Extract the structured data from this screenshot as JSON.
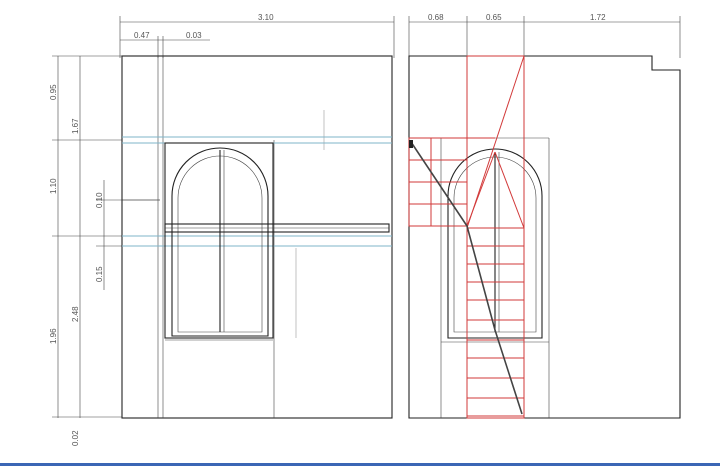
{
  "drawing": {
    "colors": {
      "line": "#222222",
      "dimension": "#555555",
      "stair": "#d23a3a",
      "cyan": "#7fb4c8",
      "bar": "#3b66b5"
    },
    "dimensions": {
      "top_total": "3.10",
      "top_a": "0.47",
      "top_b": "0.03",
      "top_right_a": "0.68",
      "top_right_b": "0.65",
      "top_right_c": "1.72",
      "left_a": "0.95",
      "left_b": "1.67",
      "left_c": "1.10",
      "left_d": "0.10",
      "left_e": "0.15",
      "left_f": "2.48",
      "left_g": "1.96",
      "left_h": "0.02"
    }
  }
}
